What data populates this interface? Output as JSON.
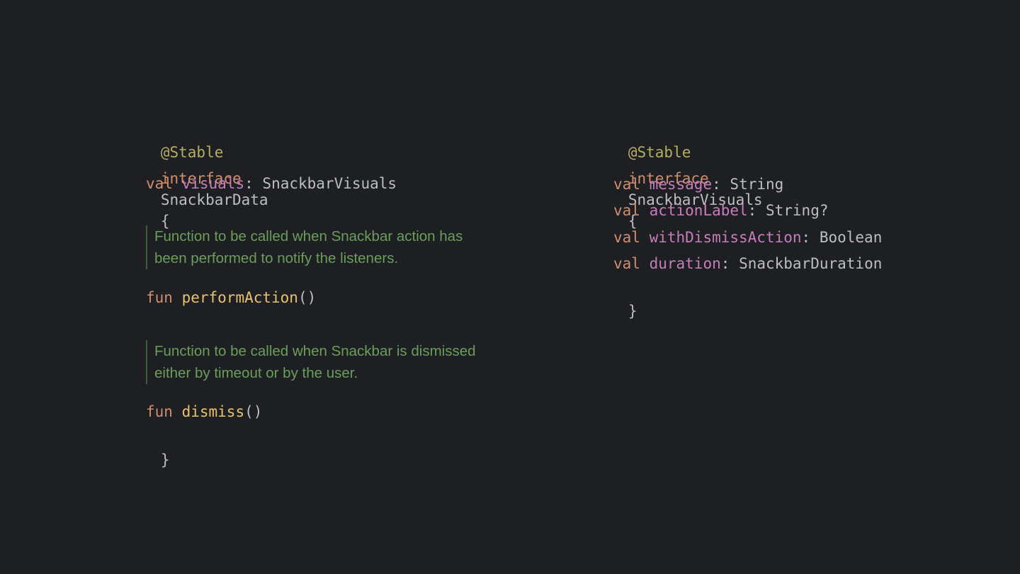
{
  "left": {
    "annotation": "@Stable",
    "decl_keyword": "interface",
    "decl_name": "SnackbarData",
    "open_brace": "{",
    "visuals_line": {
      "keyword": "val",
      "name": "visuals",
      "colon": ":",
      "type": "SnackbarVisuals"
    },
    "doc1": {
      "line1": "Function to be called when Snackbar action has",
      "line2": "been performed to notify the listeners."
    },
    "perform_line": {
      "keyword": "fun",
      "name": "performAction",
      "parens": "()"
    },
    "doc2": {
      "line1": "Function to be called when Snackbar is dismissed",
      "line2": "either by timeout or by the user."
    },
    "dismiss_line": {
      "keyword": "fun",
      "name": "dismiss",
      "parens": "()"
    },
    "close_brace": "}"
  },
  "right": {
    "annotation": "@Stable",
    "decl_keyword": "interface",
    "decl_name": "SnackbarVisuals",
    "open_brace": "{",
    "props": [
      {
        "keyword": "val",
        "name": "message",
        "colon": ":",
        "type": "String"
      },
      {
        "keyword": "val",
        "name": "actionLabel",
        "colon": ":",
        "type": "String?"
      },
      {
        "keyword": "val",
        "name": "withDismissAction",
        "colon": ":",
        "type": "Boolean"
      },
      {
        "keyword": "val",
        "name": "duration",
        "colon": ":",
        "type": "SnackbarDuration"
      }
    ],
    "close_brace": "}"
  },
  "colors": {
    "background": "#1e1f22",
    "annotation": "#b3ae60",
    "keyword": "#cf8e6d",
    "property": "#c77dbb",
    "function": "#e8c26b",
    "doc_comment": "#6a9e5a",
    "text": "#bcbec4"
  }
}
